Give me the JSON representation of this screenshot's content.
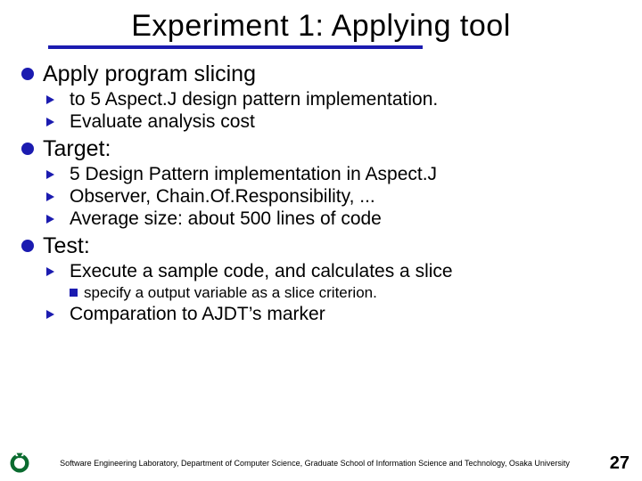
{
  "title": "Experiment 1: Applying tool",
  "sections": [
    {
      "label": "Apply program slicing",
      "items": [
        {
          "text": "to 5 Aspect.J design pattern implementation."
        },
        {
          "text": "Evaluate analysis cost"
        }
      ]
    },
    {
      "label": "Target:",
      "items": [
        {
          "text": "5 Design Pattern implementation in Aspect.J"
        },
        {
          "text": "Observer, Chain.Of.Responsibility, ..."
        },
        {
          "text": "Average size: about 500 lines of code"
        }
      ]
    },
    {
      "label": "Test:",
      "items": [
        {
          "text": "Execute a sample code, and calculates a slice",
          "sub": [
            {
              "text": "specify a output variable as a slice criterion."
            }
          ]
        },
        {
          "text": "Comparation to AJDT’s marker"
        }
      ]
    }
  ],
  "footer": {
    "lab": "Software Engineering Laboratory, Department of Computer Science, Graduate School of Information Science and Technology, Osaka University",
    "page": "27"
  }
}
